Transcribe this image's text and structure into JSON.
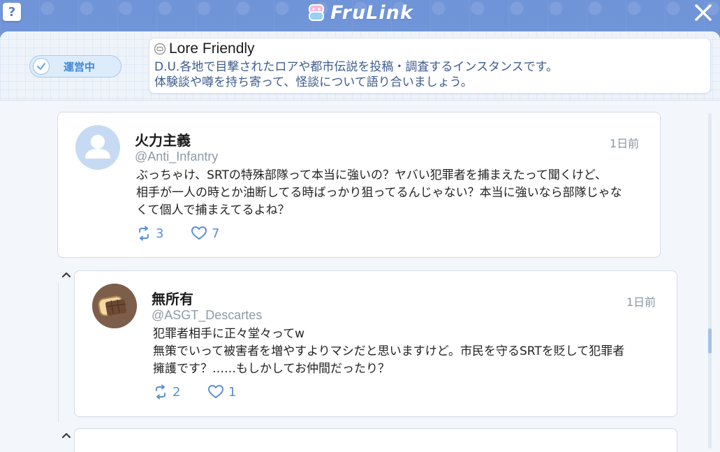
{
  "header": {
    "help_label": "?",
    "brand_name": "FruLink",
    "brand_logo_icon": "frulink-logo-icon",
    "close_icon": "close-icon"
  },
  "instance": {
    "status_label": "運営中",
    "status_icon": "check-circle-icon",
    "title_icon": "chat-bubble-icon",
    "title": "Lore Friendly",
    "desc_line1": "D.U.各地で目撃されたロアや都市伝説を投稿・調査するインスタンスです。",
    "desc_line2": "体験談や噂を持ち寄って、怪談について語り合いましょう。"
  },
  "posts": [
    {
      "author": "火力主義",
      "handle": "@Anti_Infantry",
      "time": "1日前",
      "body": [
        "ぶっちゃけ、SRTの特殊部隊って本当に強いの？ヤバい犯罪者を捕まえたって聞くけど、",
        "相手が一人の時とか油断してる時ばっかり狙ってるんじゃない？本当に強いなら部隊じゃな",
        "くて個人で捕まえてるよね？"
      ],
      "reposts": "3",
      "likes": "7"
    },
    {
      "author": "無所有",
      "handle": "@ASGT_Descartes",
      "time": "1日前",
      "body": [
        "犯罪者相手に正々堂々ってw",
        "無策でいって被害者を増やすよりマシだと思いますけど。市民を守るSRTを貶して犯罪者",
        "擁護です？……もしかしてお仲間だったり？"
      ],
      "reposts": "2",
      "likes": "1"
    }
  ],
  "colors": {
    "accent": "#5a8fd6",
    "header_bg": "#7aa0e2",
    "status_text": "#3f86d8"
  }
}
